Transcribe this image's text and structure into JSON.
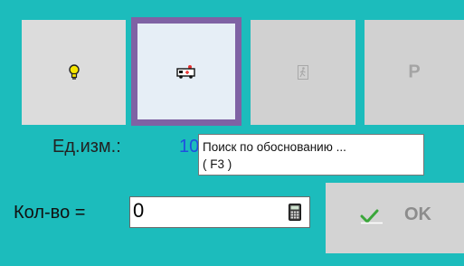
{
  "colors": {
    "background": "#1cbcbc",
    "selected_border": "#7f62a4",
    "unit_value": "#1f4fe0"
  },
  "tiles": [
    {
      "icon": "lightbulb-icon"
    },
    {
      "icon": "ambulance-icon",
      "selected": true
    },
    {
      "icon": "running-man-icon"
    },
    {
      "letter": "P"
    }
  ],
  "unit": {
    "label": "Ед.изм.:",
    "value": "10"
  },
  "tooltip": {
    "line1": "Поиск по обоснованию ...",
    "line2": "( F3 )"
  },
  "quantity": {
    "label": "Кол-во =",
    "value": "0",
    "icon": "calculator-icon"
  },
  "ok_button": {
    "label": "OK",
    "icon": "checkmark-icon"
  }
}
